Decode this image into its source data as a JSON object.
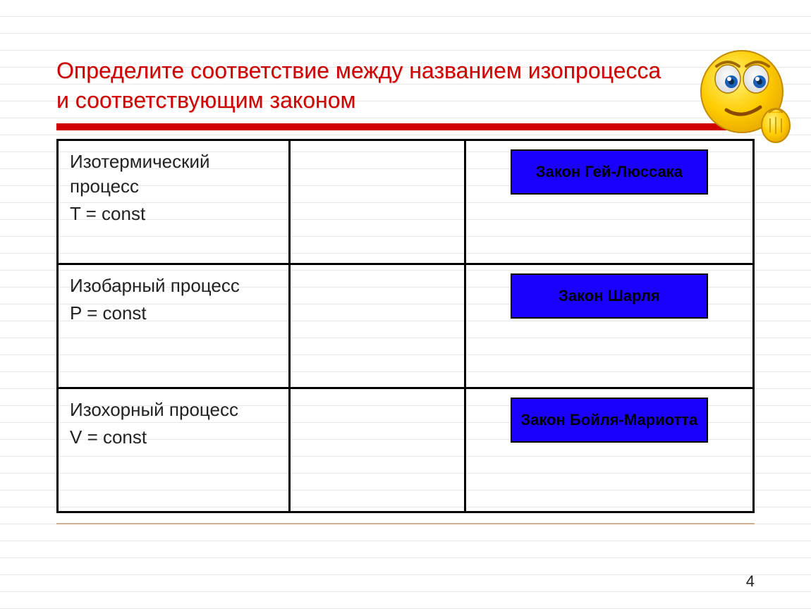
{
  "title": "Определите соответствие между названием изопроцесса и соответствующим законом",
  "rows": [
    {
      "process_name": "Изотермический процесс",
      "equation": "T = const",
      "law": "Закон Гей-Люссака"
    },
    {
      "process_name": "Изобарный процесс",
      "equation": "P = const",
      "law": "Закон Шарля"
    },
    {
      "process_name": "Изохорный процесс",
      "equation": "V = const",
      "law": "Закон Бойля-Мариотта"
    }
  ],
  "page_number": "4"
}
